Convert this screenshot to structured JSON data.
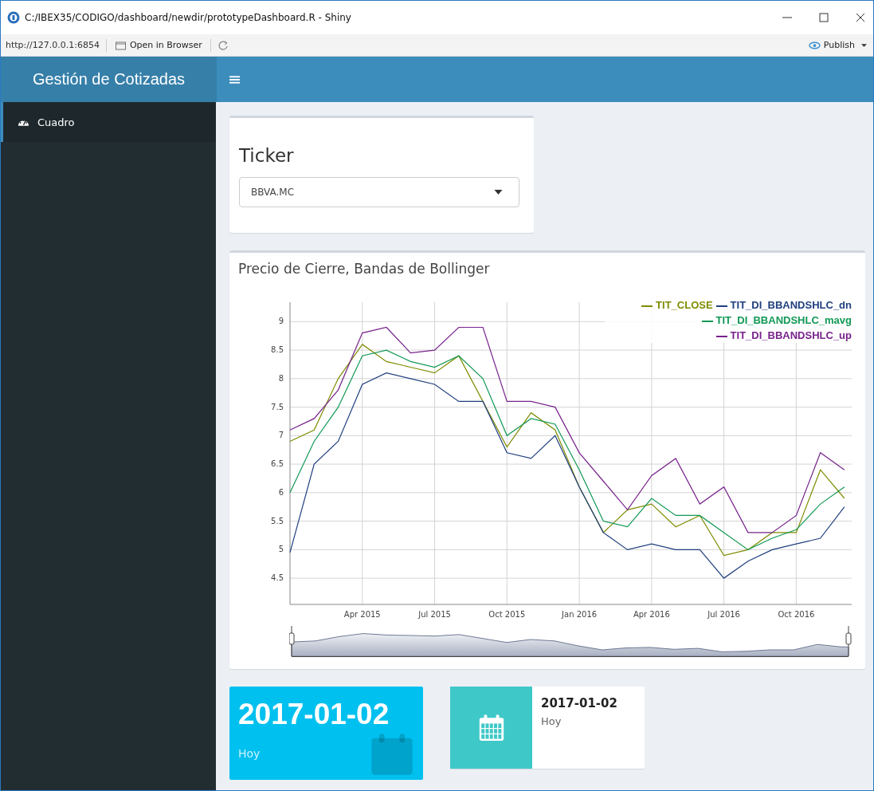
{
  "window": {
    "title": "C:/IBEX35/CODIGO/dashboard/newdir/prototypeDashboard.R - Shiny"
  },
  "toolbar": {
    "url": "http://127.0.0.1:6854",
    "open_button": "Open in Browser",
    "publish_button": "Publish"
  },
  "header": {
    "brand": "Gestión de Cotizadas"
  },
  "sidebar": {
    "items": [
      {
        "label": "Cuadro",
        "selected": true
      }
    ]
  },
  "ticker_box": {
    "title": "Ticker",
    "select": {
      "value": "BBVA.MC"
    }
  },
  "chart_box": {
    "title": "Precio de Cierre, Bandas de Bollinger",
    "chart_data": {
      "type": "line",
      "categories": [
        null,
        null,
        null,
        "Apr 2015",
        null,
        null,
        "Jul 2015",
        null,
        null,
        "Oct 2015",
        null,
        null,
        "Jan 2016",
        null,
        null,
        "Apr 2016",
        null,
        null,
        "Jul 2016",
        null,
        null,
        "Oct 2016",
        null,
        null
      ],
      "grid": true,
      "legend": true,
      "series": [
        {
          "name": "TIT_CLOSE",
          "color": "#7f8c00",
          "values": [
            6.9,
            7.1,
            8.0,
            8.6,
            8.3,
            8.2,
            8.1,
            8.4,
            7.6,
            6.8,
            7.4,
            7.1,
            6.1,
            5.3,
            5.7,
            5.8,
            5.4,
            5.6,
            4.9,
            5.0,
            5.3,
            5.3,
            6.4,
            5.9
          ]
        },
        {
          "name": "TIT_DI_BBANDSHLC_dn",
          "color": "#1f3f7f",
          "values": [
            4.95,
            6.5,
            6.9,
            7.9,
            8.1,
            8.0,
            7.9,
            7.6,
            7.6,
            6.7,
            6.6,
            7.0,
            6.1,
            5.3,
            5.0,
            5.1,
            5.0,
            5.0,
            4.5,
            4.8,
            5.0,
            5.1,
            5.2,
            5.75
          ]
        },
        {
          "name": "TIT_DI_BBANDSHLC_mavg",
          "color": "#119955",
          "values": [
            6.0,
            6.9,
            7.5,
            8.4,
            8.5,
            8.3,
            8.2,
            8.4,
            8.0,
            7.0,
            7.3,
            7.2,
            6.4,
            5.5,
            5.4,
            5.9,
            5.6,
            5.6,
            5.3,
            5.0,
            5.2,
            5.35,
            5.8,
            6.1
          ]
        },
        {
          "name": "TIT_DI_BBANDSHLC_up",
          "color": "#77228b",
          "values": [
            7.1,
            7.3,
            7.8,
            8.8,
            8.9,
            8.45,
            8.5,
            8.9,
            8.9,
            7.6,
            7.6,
            7.5,
            6.7,
            6.2,
            5.7,
            6.3,
            6.6,
            5.8,
            6.1,
            5.3,
            5.3,
            5.6,
            6.7,
            6.4
          ]
        }
      ],
      "ylim": [
        4.04,
        9.34
      ],
      "yticks": [
        4.5,
        5,
        5.5,
        6,
        6.5,
        7,
        7.5,
        8,
        8.5,
        9
      ]
    }
  },
  "value_box": {
    "value": "2017-01-02",
    "subtitle": "Hoy"
  },
  "info_box": {
    "value": "2017-01-02",
    "subtitle": "Hoy"
  }
}
